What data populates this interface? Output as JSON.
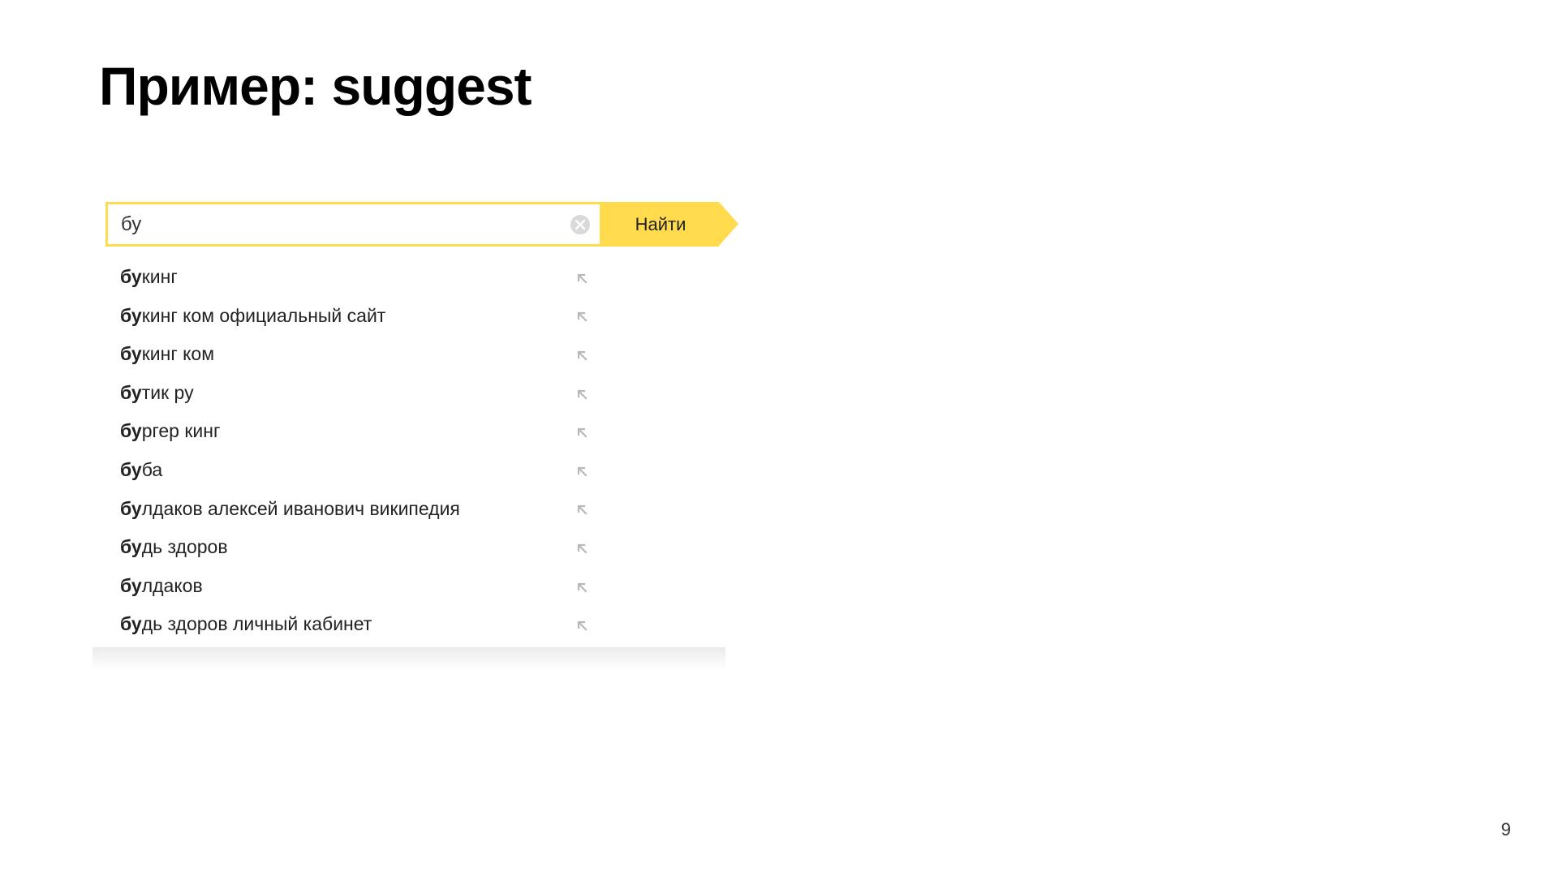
{
  "slide": {
    "title": "Пример: suggest",
    "page_number": "9"
  },
  "search": {
    "query": "бу",
    "button_label": "Найти",
    "bold_prefix": "бу",
    "suggestions": [
      {
        "prefix": "бу",
        "rest": "кинг"
      },
      {
        "prefix": "бу",
        "rest": "кинг ком официальный сайт"
      },
      {
        "prefix": "бу",
        "rest": "кинг ком"
      },
      {
        "prefix": "бу",
        "rest": "тик ру"
      },
      {
        "prefix": "бу",
        "rest": "ргер кинг"
      },
      {
        "prefix": "бу",
        "rest": "ба"
      },
      {
        "prefix": "бу",
        "rest": "лдаков алексей иванович википедия"
      },
      {
        "prefix": "бу",
        "rest": "дь здоров"
      },
      {
        "prefix": "бу",
        "rest": "лдаков"
      },
      {
        "prefix": "бу",
        "rest": "дь здоров личный кабинет"
      }
    ]
  }
}
